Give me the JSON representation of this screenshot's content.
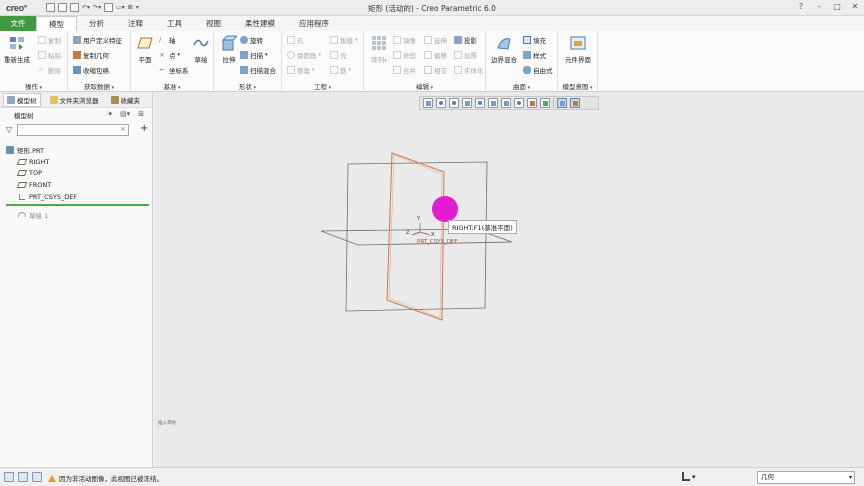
{
  "titlebar": {
    "logo": "creo°",
    "title": "矩形 (活动的) - Creo Parametric 6.0"
  },
  "tabs": [
    {
      "label": "文件"
    },
    {
      "label": "模型"
    },
    {
      "label": "分析"
    },
    {
      "label": "注释"
    },
    {
      "label": "工具"
    },
    {
      "label": "视图"
    },
    {
      "label": "柔性建模"
    },
    {
      "label": "应用程序"
    }
  ],
  "ribbon": {
    "operations": {
      "label": "操作",
      "regenerate": "重新生成",
      "copy": "复制",
      "paste": "粘贴",
      "delete": "删除"
    },
    "getdata": {
      "label": "获取数据",
      "udf": "用户定义特征",
      "copygeom": "复制几何",
      "shrinkwrap": "收缩包络"
    },
    "datum": {
      "label": "基准",
      "plane": "平面",
      "axis": "轴",
      "point": "点",
      "csys": "坐标系",
      "sketch": "草绘"
    },
    "shapes": {
      "label": "形状",
      "extrude": "拉伸",
      "revolve": "旋转",
      "sweep": "扫描",
      "sweptblend": "扫描混合"
    },
    "engineering": {
      "label": "工程",
      "hole": "孔",
      "rib": "筋",
      "chamfer": "倒角",
      "draft": "拔模",
      "round": "倒圆角",
      "shell": "壳"
    },
    "editing": {
      "label": "编辑",
      "pattern": "阵列",
      "mirror": "镜像",
      "trim": "修剪",
      "merge": "合并",
      "extend": "延伸",
      "offset": "偏移",
      "intersect": "相交",
      "project": "投影",
      "thicken": "加厚",
      "solidify": "实体化"
    },
    "surfaces": {
      "label": "曲面",
      "boundaryblend": "边界混合",
      "fill": "填充",
      "style": "样式",
      "freestyle": "自由式"
    },
    "intent": {
      "label": "模型意图",
      "compinterface": "元件界面"
    }
  },
  "navigator": {
    "tabs": [
      {
        "label": "模型树"
      },
      {
        "label": "文件夹浏览器"
      },
      {
        "label": "收藏夹"
      }
    ],
    "header": "模型树",
    "filter_placeholder": "",
    "clear_glyph": "×",
    "add_glyph": "+",
    "tree": {
      "root": "矩形.PRT",
      "items": [
        {
          "label": "RIGHT"
        },
        {
          "label": "TOP"
        },
        {
          "label": "FRONT"
        },
        {
          "label": "PRT_CSYS_DEF"
        }
      ],
      "sketch": "草绘 1"
    }
  },
  "viewport": {
    "tooltip": "RIGHT:F1(基准平面)",
    "csys_label": "PRT_CSYS_DEF",
    "axis_x": "X",
    "axis_y": "Y",
    "axis_z": "Z",
    "corner_text": "插入草绘"
  },
  "statusbar": {
    "message": "因为非活动图像，此视图已被冻结。",
    "selection_filter": "几何",
    "selection_mode": "▾"
  }
}
